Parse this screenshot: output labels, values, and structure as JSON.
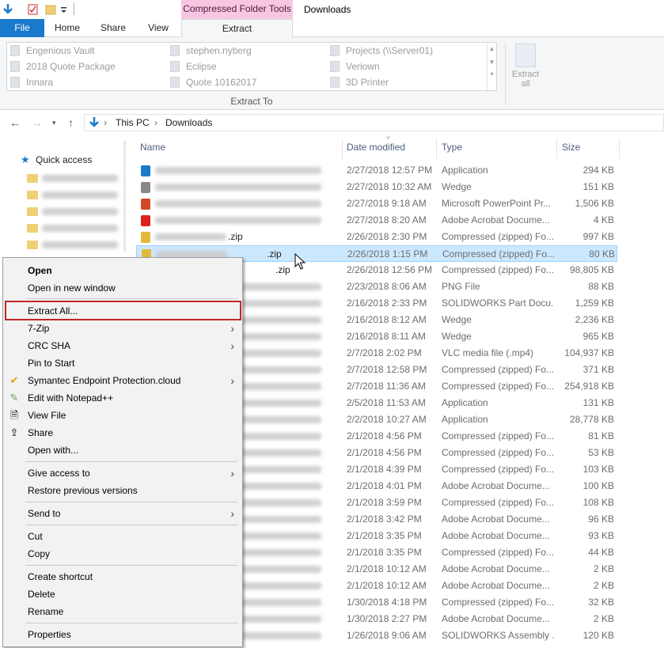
{
  "window": {
    "title": "Downloads",
    "contextual_tab_group": "Compressed Folder Tools"
  },
  "ribbon": {
    "tabs": [
      "File",
      "Home",
      "Share",
      "View",
      "Extract"
    ],
    "extract_to_label": "Extract To",
    "extract_all_label_1": "Extract",
    "extract_all_label_2": "all",
    "destinations": [
      "Engenious Vault",
      "stephen.nyberg",
      "Projects (\\\\Server01)",
      "2018 Quote Package",
      "Eclipse",
      "Veriown",
      "Innara",
      "Quote 10162017",
      "3D Printer"
    ]
  },
  "address": {
    "crumbs": [
      "This PC",
      "Downloads"
    ]
  },
  "nav": {
    "quick_access": "Quick access"
  },
  "columns": {
    "name": "Name",
    "date": "Date modified",
    "type": "Type",
    "size": "Size"
  },
  "files": [
    {
      "name": "",
      "date": "2/27/2018 12:57 PM",
      "type": "Application",
      "size": "294 KB"
    },
    {
      "name": "",
      "date": "2/27/2018 10:32 AM",
      "type": "Wedge",
      "size": "151 KB"
    },
    {
      "name": "",
      "date": "2/27/2018 9:18 AM",
      "type": "Microsoft PowerPoint Pr...",
      "size": "1,506 KB"
    },
    {
      "name": "",
      "date": "2/27/2018 8:20 AM",
      "type": "Adobe Acrobat Docume...",
      "size": "4 KB"
    },
    {
      "name": ".zip",
      "date": "2/26/2018 2:30 PM",
      "type": "Compressed (zipped) Fo...",
      "size": "997 KB"
    },
    {
      "name": ".zip",
      "date": "2/26/2018 1:15 PM",
      "type": "Compressed (zipped) Fo...",
      "size": "80 KB"
    },
    {
      "name": ".zip",
      "date": "2/26/2018 12:56 PM",
      "type": "Compressed (zipped) Fo...",
      "size": "98,805 KB"
    },
    {
      "name": "",
      "date": "2/23/2018 8:06 AM",
      "type": "PNG File",
      "size": "88 KB"
    },
    {
      "name": "",
      "date": "2/16/2018 2:33 PM",
      "type": "SOLIDWORKS Part Docu...",
      "size": "1,259 KB"
    },
    {
      "name": "",
      "date": "2/16/2018 8:12 AM",
      "type": "Wedge",
      "size": "2,236 KB"
    },
    {
      "name": "",
      "date": "2/16/2018 8:11 AM",
      "type": "Wedge",
      "size": "965 KB"
    },
    {
      "name": "",
      "date": "2/7/2018 2:02 PM",
      "type": "VLC media file (.mp4)",
      "size": "104,937 KB"
    },
    {
      "name": "",
      "date": "2/7/2018 12:58 PM",
      "type": "Compressed (zipped) Fo...",
      "size": "371 KB"
    },
    {
      "name": "",
      "date": "2/7/2018 11:36 AM",
      "type": "Compressed (zipped) Fo...",
      "size": "254,918 KB"
    },
    {
      "name": "",
      "date": "2/5/2018 11:53 AM",
      "type": "Application",
      "size": "131 KB"
    },
    {
      "name": "",
      "date": "2/2/2018 10:27 AM",
      "type": "Application",
      "size": "28,778 KB"
    },
    {
      "name": "",
      "date": "2/1/2018 4:56 PM",
      "type": "Compressed (zipped) Fo...",
      "size": "81 KB"
    },
    {
      "name": "",
      "date": "2/1/2018 4:56 PM",
      "type": "Compressed (zipped) Fo...",
      "size": "53 KB"
    },
    {
      "name": "",
      "date": "2/1/2018 4:39 PM",
      "type": "Compressed (zipped) Fo...",
      "size": "103 KB"
    },
    {
      "name": "",
      "date": "2/1/2018 4:01 PM",
      "type": "Adobe Acrobat Docume...",
      "size": "100 KB"
    },
    {
      "name": "",
      "date": "2/1/2018 3:59 PM",
      "type": "Compressed (zipped) Fo...",
      "size": "108 KB"
    },
    {
      "name": "",
      "date": "2/1/2018 3:42 PM",
      "type": "Adobe Acrobat Docume...",
      "size": "96 KB"
    },
    {
      "name": "",
      "date": "2/1/2018 3:35 PM",
      "type": "Adobe Acrobat Docume...",
      "size": "93 KB"
    },
    {
      "name": "",
      "date": "2/1/2018 3:35 PM",
      "type": "Compressed (zipped) Fo...",
      "size": "44 KB"
    },
    {
      "name": "",
      "date": "2/1/2018 10:12 AM",
      "type": "Adobe Acrobat Docume...",
      "size": "2 KB"
    },
    {
      "name": "",
      "date": "2/1/2018 10:12 AM",
      "type": "Adobe Acrobat Docume...",
      "size": "2 KB"
    },
    {
      "name": "",
      "date": "1/30/2018 4:18 PM",
      "type": "Compressed (zipped) Fo...",
      "size": "32 KB"
    },
    {
      "name": "",
      "date": "1/30/2018 2:27 PM",
      "type": "Adobe Acrobat Docume...",
      "size": "2 KB"
    },
    {
      "name": "",
      "date": "1/26/2018 9:06 AM",
      "type": "SOLIDWORKS Assembly ...",
      "size": "120 KB"
    }
  ],
  "context_menu": {
    "open": "Open",
    "open_new_window": "Open in new window",
    "extract_all": "Extract All...",
    "seven_zip": "7-Zip",
    "crc_sha": "CRC SHA",
    "pin_to_start": "Pin to Start",
    "symantec": "Symantec Endpoint Protection.cloud",
    "notepadpp": "Edit with Notepad++",
    "view_file": "View File",
    "share": "Share",
    "open_with": "Open with...",
    "give_access": "Give access to",
    "restore_versions": "Restore previous versions",
    "send_to": "Send to",
    "cut": "Cut",
    "copy": "Copy",
    "create_shortcut": "Create shortcut",
    "delete": "Delete",
    "rename": "Rename",
    "properties": "Properties"
  }
}
